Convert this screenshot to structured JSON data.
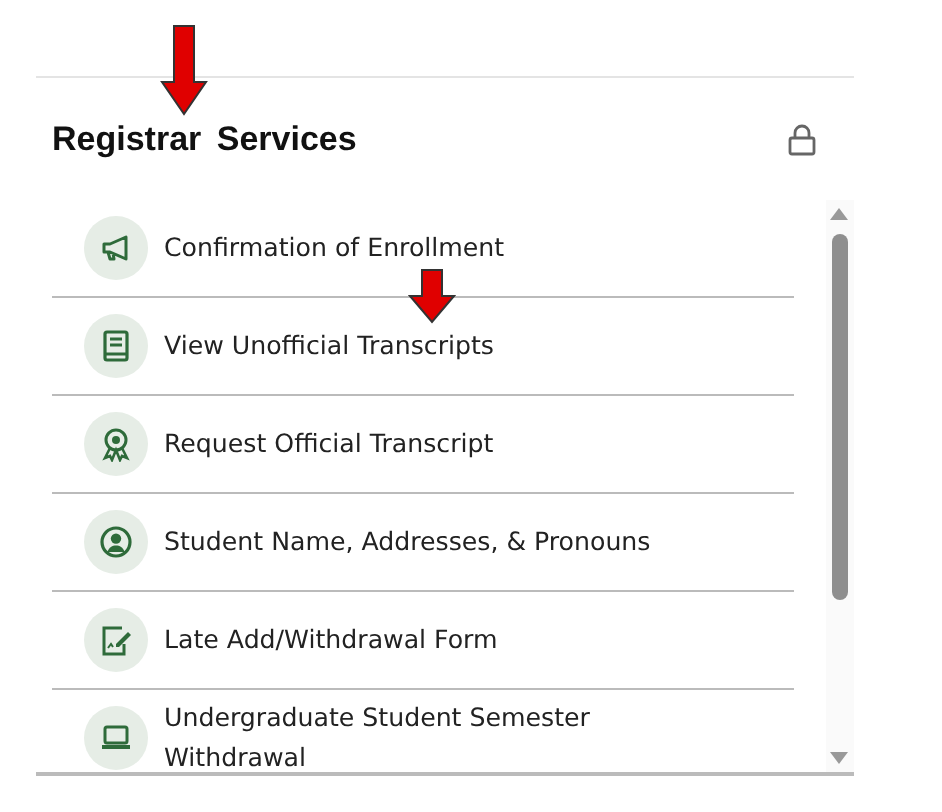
{
  "panel": {
    "title": "Registrar Services",
    "locked": true
  },
  "items": [
    {
      "label": "Confirmation of Enrollment",
      "kind": "megaphone"
    },
    {
      "label": "View Unofficial Transcripts",
      "kind": "book"
    },
    {
      "label": "Request Official Transcript",
      "kind": "award"
    },
    {
      "label": "Student Name, Addresses, & Pronouns",
      "kind": "person"
    },
    {
      "label": "Late Add/Withdrawal Form",
      "kind": "form"
    },
    {
      "label": "Undergraduate Student Semester Withdrawal",
      "kind": "laptop"
    }
  ]
}
